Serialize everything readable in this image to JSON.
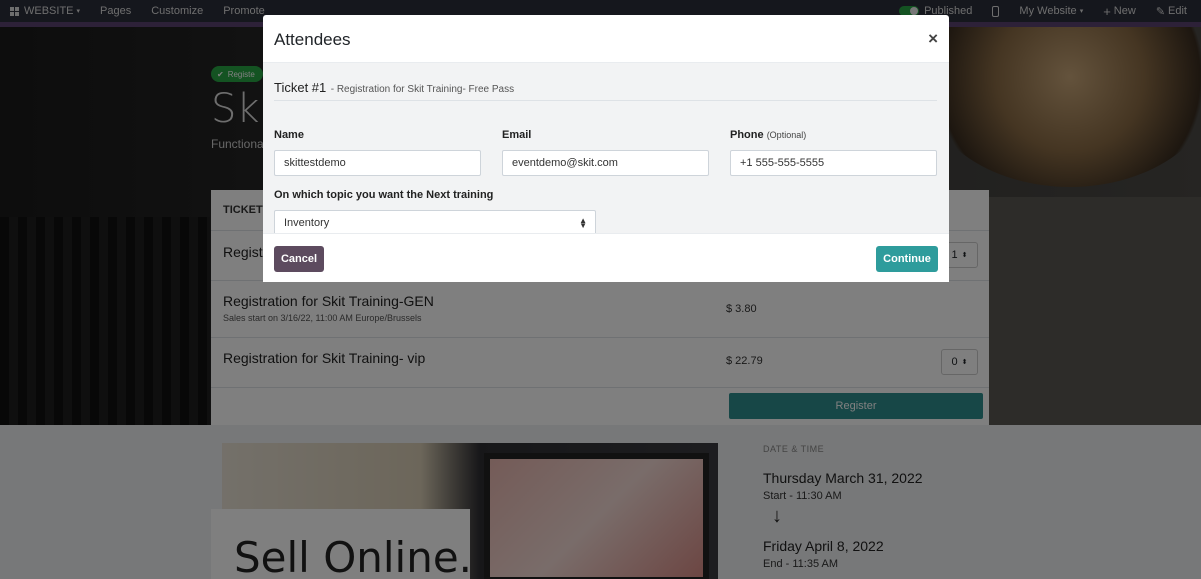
{
  "topbar": {
    "website_menu": "WEBSITE",
    "nav": [
      "Pages",
      "Customize",
      "Promote"
    ],
    "published": "Published",
    "my_website": "My Website",
    "new": "New",
    "edit": "Edit"
  },
  "page": {
    "badge": "Registe",
    "title": "Skit",
    "subtitle": "Functiona",
    "tickets_header": "TICKETS",
    "tickets": [
      {
        "name": "Registr",
        "sub": "",
        "price": "",
        "qty": "1"
      },
      {
        "name": "Registration for Skit Training-GEN",
        "sub": "Sales start on 3/16/22, 11:00 AM Europe/Brussels",
        "price": "$ 3.80",
        "qty": ""
      },
      {
        "name": "Registration for Skit Training- vip",
        "sub": "",
        "price": "$ 22.79",
        "qty": "0"
      }
    ],
    "register_button": "Register",
    "promo_text": "Sell Online.",
    "date_time": {
      "label": "DATE & TIME",
      "start_date": "Thursday March 31, 2022",
      "start_time": "Start - 11:30 AM",
      "arrow": "↓",
      "end_date": "Friday April 8, 2022",
      "end_time": "End - 11:35 AM"
    }
  },
  "modal": {
    "title": "Attendees",
    "close": "×",
    "ticket_number": "Ticket #1",
    "ticket_desc": "- Registration for Skit Training- Free Pass",
    "fields": {
      "name_label": "Name",
      "name_value": "skittestdemo",
      "email_label": "Email",
      "email_value": "eventdemo@skit.com",
      "phone_label": "Phone",
      "phone_optional": "(Optional)",
      "phone_value": "+1 555-555-5555",
      "topic_label": "On which topic you want the Next training",
      "topic_value": "Inventory"
    },
    "cancel": "Cancel",
    "continue": "Continue"
  },
  "colors": {
    "topbar": "#2b2f3b",
    "accent_purple": "#5a4370",
    "cancel_button": "#5d4b5f",
    "continue_button": "#2e9c9c",
    "published_toggle": "#28a745"
  }
}
